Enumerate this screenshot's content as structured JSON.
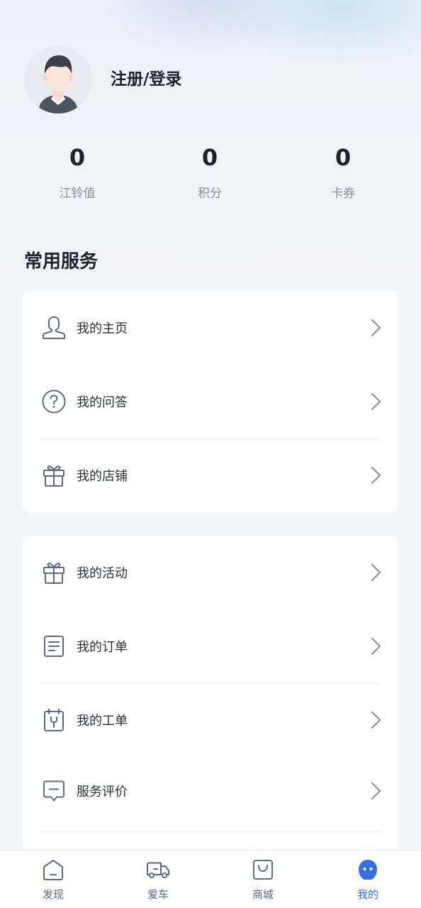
{
  "profile": {
    "login_label": "注册/登录"
  },
  "stats": [
    {
      "value": "0",
      "label": "江铃值"
    },
    {
      "value": "0",
      "label": "积分"
    },
    {
      "value": "0",
      "label": "卡券"
    }
  ],
  "services": {
    "title": "常用服务",
    "group1": [
      {
        "label": "我的主页",
        "icon": "user-profile-icon"
      },
      {
        "label": "我的问答",
        "icon": "question-icon"
      },
      {
        "label": "我的店铺",
        "icon": "gift-shop-icon"
      }
    ],
    "group2": [
      {
        "label": "我的活动",
        "icon": "gift-activity-icon"
      },
      {
        "label": "我的订单",
        "icon": "order-document-icon"
      },
      {
        "label": "我的工单",
        "icon": "wrench-clipboard-icon"
      },
      {
        "label": "服务评价",
        "icon": "comment-icon"
      }
    ]
  },
  "tabbar": {
    "items": [
      {
        "label": "发现",
        "icon": "home-icon"
      },
      {
        "label": "爱车",
        "icon": "truck-icon"
      },
      {
        "label": "商城",
        "icon": "shopping-bag-icon"
      },
      {
        "label": "我的",
        "icon": "me-face-icon"
      }
    ],
    "active_index": 3
  },
  "colors": {
    "icon_stroke": "#5a6a88",
    "accent": "#3a6fe0",
    "background": "#f4f5f8"
  }
}
